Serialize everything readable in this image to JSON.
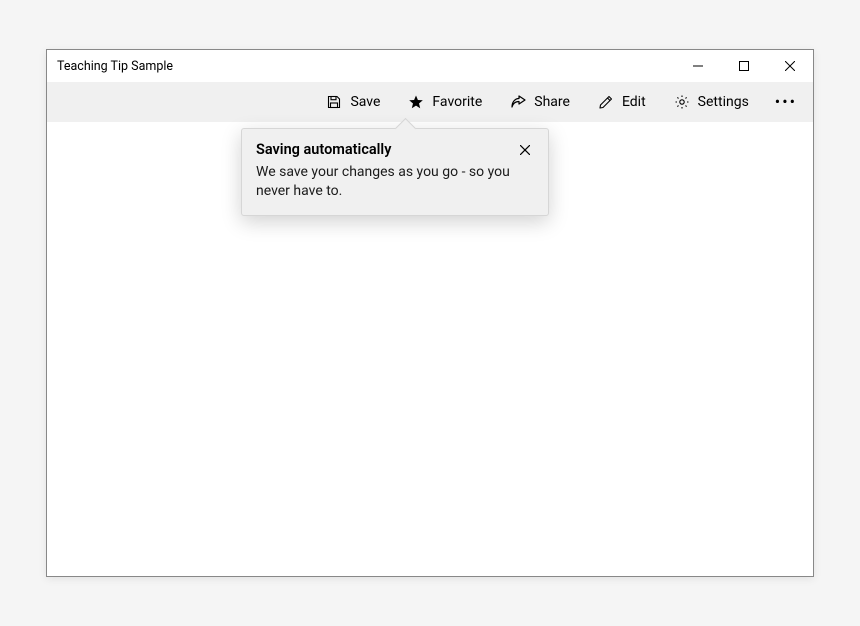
{
  "window": {
    "title": "Teaching Tip Sample"
  },
  "commandbar": {
    "save": "Save",
    "favorite": "Favorite",
    "share": "Share",
    "edit": "Edit",
    "settings": "Settings"
  },
  "teachingTip": {
    "title": "Saving automatically",
    "subtitle": "We save your changes as you go - so you never have to."
  }
}
